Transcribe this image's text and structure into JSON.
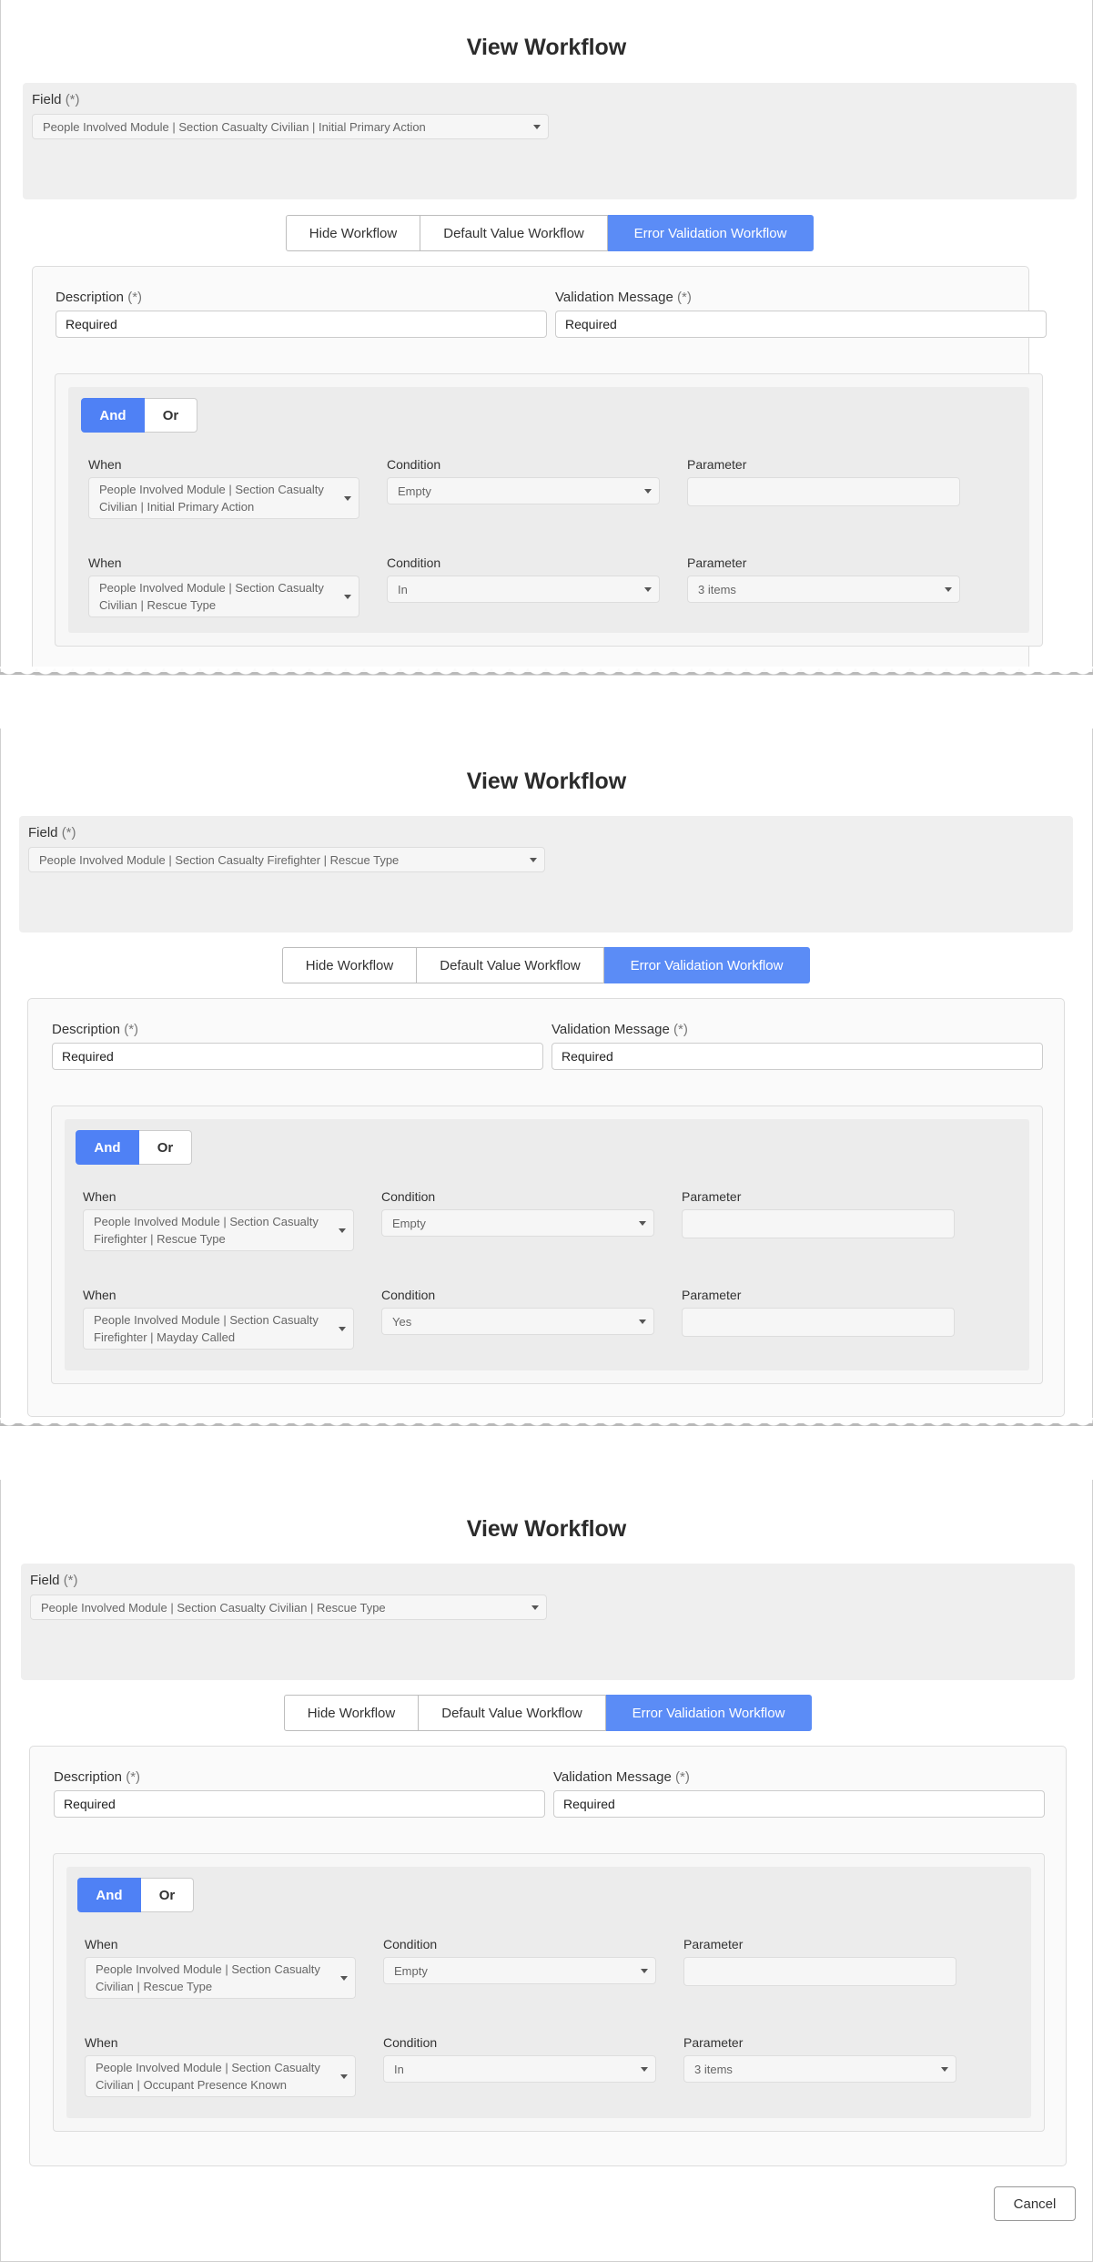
{
  "panels": [
    {
      "title": "View Workflow",
      "field": {
        "label": "Field",
        "req": "(*)",
        "value": "People Involved Module | Section Casualty Civilian | Initial Primary Action"
      },
      "tabs": [
        "Hide Workflow",
        "Default Value Workflow",
        "Error Validation Workflow"
      ],
      "description": {
        "label": "Description",
        "req": "(*)",
        "value": "Required"
      },
      "validation": {
        "label": "Validation Message",
        "req": "(*)",
        "value": "Required"
      },
      "logic": {
        "and": "And",
        "or": "Or"
      },
      "rows": [
        {
          "when_label": "When",
          "when_l1": "People Involved Module | Section Casualty",
          "when_l2": "Civilian | Initial Primary Action",
          "cond_label": "Condition",
          "cond": "Empty",
          "param_label": "Parameter",
          "param": ""
        },
        {
          "when_label": "When",
          "when_l1": "People Involved Module | Section Casualty",
          "when_l2": "Civilian | Rescue Type",
          "cond_label": "Condition",
          "cond": "In",
          "param_label": "Parameter",
          "param": "3 items"
        }
      ]
    },
    {
      "title": "View Workflow",
      "field": {
        "label": "Field",
        "req": "(*)",
        "value": "People Involved Module | Section Casualty Firefighter | Rescue Type"
      },
      "tabs": [
        "Hide Workflow",
        "Default Value Workflow",
        "Error Validation Workflow"
      ],
      "description": {
        "label": "Description",
        "req": "(*)",
        "value": "Required"
      },
      "validation": {
        "label": "Validation Message",
        "req": "(*)",
        "value": "Required"
      },
      "logic": {
        "and": "And",
        "or": "Or"
      },
      "rows": [
        {
          "when_label": "When",
          "when_l1": "People Involved Module | Section Casualty",
          "when_l2": "Firefighter | Rescue Type",
          "cond_label": "Condition",
          "cond": "Empty",
          "param_label": "Parameter",
          "param": ""
        },
        {
          "when_label": "When",
          "when_l1": "People Involved Module | Section Casualty",
          "when_l2": "Firefighter | Mayday Called",
          "cond_label": "Condition",
          "cond": "Yes",
          "param_label": "Parameter",
          "param": ""
        }
      ]
    },
    {
      "title": "View Workflow",
      "field": {
        "label": "Field",
        "req": "(*)",
        "value": "People Involved Module | Section Casualty Civilian | Rescue Type"
      },
      "tabs": [
        "Hide Workflow",
        "Default Value Workflow",
        "Error Validation Workflow"
      ],
      "description": {
        "label": "Description",
        "req": "(*)",
        "value": "Required"
      },
      "validation": {
        "label": "Validation Message",
        "req": "(*)",
        "value": "Required"
      },
      "logic": {
        "and": "And",
        "or": "Or"
      },
      "rows": [
        {
          "when_label": "When",
          "when_l1": "People Involved Module | Section Casualty",
          "when_l2": "Civilian | Rescue Type",
          "cond_label": "Condition",
          "cond": "Empty",
          "param_label": "Parameter",
          "param": ""
        },
        {
          "when_label": "When",
          "when_l1": "People Involved Module | Section Casualty",
          "when_l2": "Civilian | Occupant Presence Known",
          "cond_label": "Condition",
          "cond": "In",
          "param_label": "Parameter",
          "param": "3 items"
        }
      ]
    }
  ],
  "footer": {
    "cancel": "Cancel"
  },
  "icons": {
    "dropdown": "chevron-down-icon"
  },
  "colors": {
    "accent": "#5b8cf6",
    "and_active": "#4f81f5"
  }
}
